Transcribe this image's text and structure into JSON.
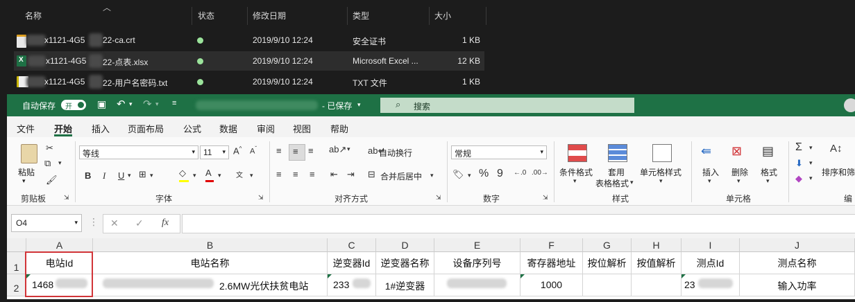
{
  "explorer": {
    "columns": {
      "name": "名称",
      "status": "状态",
      "modified": "修改日期",
      "type": "类型",
      "size": "大小"
    },
    "files": [
      {
        "name_a": "x1121-4G5",
        "name_b": "22-ca.crt",
        "date": "2019/9/10 12:24",
        "type": "安全证书",
        "size": "1 KB"
      },
      {
        "name_a": "x1121-4G5",
        "name_b": "22-点表.xlsx",
        "date": "2019/9/10 12:24",
        "type": "Microsoft Excel ...",
        "size": "12 KB"
      },
      {
        "name_a": "x1121-4G5",
        "name_b": "22-用户名密码.txt",
        "date": "2019/9/10 12:24",
        "type": "TXT 文件",
        "size": "1 KB"
      }
    ]
  },
  "excel": {
    "autosave_label": "自动保存",
    "toggle_label": "开",
    "saved_status": "- 已保存",
    "search_placeholder": "搜索",
    "menu": [
      "文件",
      "开始",
      "插入",
      "页面布局",
      "公式",
      "数据",
      "审阅",
      "视图",
      "帮助"
    ],
    "ribbon": {
      "paste": "粘贴",
      "clipboard": "剪贴板",
      "font_name": "等线",
      "font_size": "11",
      "font_group": "字体",
      "wrap_text": "自动换行",
      "merge_center": "合并后居中",
      "align_group": "对齐方式",
      "number_format": "常规",
      "number_group": "数字",
      "cond_format": "条件格式",
      "table_format_1": "套用",
      "table_format_2": "表格格式",
      "cell_style": "单元格样式",
      "styles_group": "样式",
      "insert": "插入",
      "delete": "删除",
      "format": "格式",
      "cells_group": "单元格",
      "sort_filter": "排序和筛",
      "edit_group": "编"
    },
    "name_box": "O4",
    "fx": "fx",
    "columns": [
      "A",
      "B",
      "C",
      "D",
      "E",
      "F",
      "G",
      "H",
      "I",
      "J"
    ],
    "rows": [
      "1",
      "2"
    ],
    "headers": [
      "电站Id",
      "电站名称",
      "逆变器Id",
      "逆变器名称",
      "设备序列号",
      "寄存器地址",
      "按位解析",
      "按值解析",
      "测点Id",
      "测点名称"
    ],
    "row2": {
      "A": "1468",
      "B": "2.6MW光伏扶贫电站",
      "C": "233",
      "D": "1#逆变器",
      "E": "",
      "F": "1000",
      "G": "",
      "H": "",
      "I": "23",
      "J": "输入功率"
    },
    "highlight_color": "#d13438",
    "accent_color": "#1e7145"
  }
}
